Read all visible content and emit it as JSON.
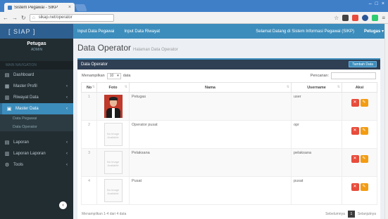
{
  "browser": {
    "tab_title": "Sistem Pegawai - SIKP",
    "tab_close": "×",
    "address": "sikap.net/operator",
    "window_controls": [
      "–",
      "□",
      "×"
    ]
  },
  "app": {
    "logo": "[ SIAP ]",
    "nav_links": [
      "Input Data Pegawai",
      "Input Data Riwayat"
    ],
    "notice": "Selamat Datang di Sistem Informasi Pegawai (SIKP)",
    "user_menu": "Petugas ▾"
  },
  "sidebar": {
    "user_name": "Petugas",
    "user_role": "ADMIN",
    "section_header": "MAIN NAVIGATION",
    "items": [
      {
        "label": "Dashboard",
        "icon": "▤",
        "caret": ""
      },
      {
        "label": "Master Profil",
        "icon": "▦",
        "caret": "‹"
      },
      {
        "label": "Riwayat Data",
        "icon": "▥",
        "caret": "‹"
      },
      {
        "label": "Master Data",
        "icon": "▣",
        "caret": "‹",
        "active": true
      }
    ],
    "sub_items": [
      "Data Pegawai",
      "Data Operator"
    ],
    "items2": [
      {
        "label": "Laporan",
        "icon": "▤",
        "caret": "‹"
      },
      {
        "label": "Laporan Laporan",
        "icon": "▥",
        "caret": "‹"
      },
      {
        "label": "Tools",
        "icon": "⚙",
        "caret": "‹"
      }
    ],
    "collapse": "‹"
  },
  "main": {
    "title": "Data Operator",
    "subtitle": "Halaman Data Operator",
    "box_title": "Data Operator",
    "add_button": "Tambah Data",
    "show_label": "Menampilkan",
    "show_value": "10",
    "show_suffix": "data",
    "search_label": "Pencarian:",
    "columns": [
      "No",
      "Foto",
      "Nama",
      "Username",
      "Aksi"
    ],
    "rows": [
      {
        "no": "1",
        "photo": "real",
        "nama": "Petugas",
        "username": "user"
      },
      {
        "no": "2",
        "photo": "blank",
        "nama": "Operator pusat",
        "username": "opr"
      },
      {
        "no": "3",
        "photo": "blank",
        "nama": "Pelaksana",
        "username": "pelaksana"
      },
      {
        "no": "4",
        "photo": "blank",
        "nama": "Pusat",
        "username": "pusat"
      }
    ],
    "photo_placeholder": "No Image Available",
    "footer_info": "Menampilkan 1-4 dari 4 data",
    "pager_prev": "Sebelumnya",
    "pager_page": "1",
    "pager_next": "Selanjutnya"
  }
}
